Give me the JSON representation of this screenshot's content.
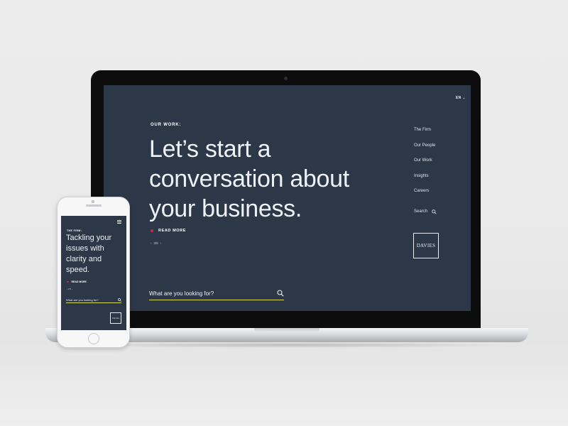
{
  "desktop": {
    "language": "EN",
    "eyebrow": "OUR WORK:",
    "headline": "Let’s start a conversation about your business.",
    "read_more": "READ MORE",
    "pager": {
      "prev": "‹",
      "current": "3/5",
      "next": "›"
    },
    "nav": [
      {
        "label": "The Firm"
      },
      {
        "label": "Our People"
      },
      {
        "label": "Our Work"
      },
      {
        "label": "Insights"
      },
      {
        "label": "Careers"
      }
    ],
    "search_nav_label": "Search",
    "logo_text": "DAVIES",
    "search_placeholder": "What are you looking for?"
  },
  "mobile": {
    "eyebrow": "THE FIRM:",
    "headline": "Tackling your issues with clarity and speed.",
    "read_more": "READ MORE",
    "pager": {
      "prev": "‹",
      "current": "1/5",
      "next": "›"
    },
    "search_placeholder": "What are you looking for?",
    "logo_text": "Davies"
  },
  "icons": {
    "search": "search-icon",
    "menu": "hamburger-menu-icon",
    "language_caret": "chevron-down-icon"
  },
  "colors": {
    "screen_bg": "#2c3748",
    "accent_red": "#d6263b",
    "search_underline": "#d8d94a",
    "text": "#eef1f5"
  }
}
